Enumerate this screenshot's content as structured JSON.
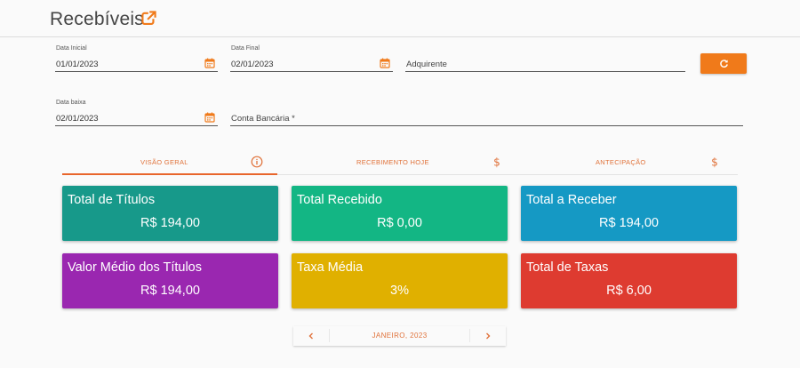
{
  "header": {
    "title": "Recebíveis",
    "icon": "external-link-icon",
    "accent": "#f07a1a"
  },
  "filters": {
    "data_inicial": {
      "label": "Data Inicial",
      "value": "01/01/2023"
    },
    "data_final": {
      "label": "Data Final",
      "value": "02/01/2023"
    },
    "adquirente": {
      "placeholder": "Adquirente"
    },
    "data_baixa": {
      "label": "Data baixa",
      "value": "02/01/2023"
    },
    "conta_bancaria": {
      "placeholder": "Conta Bancária *"
    },
    "refresh_icon": "refresh-icon"
  },
  "tabs": [
    {
      "label": "VISÃO GERAL",
      "icon": "info-icon",
      "active": true
    },
    {
      "label": "RECEBIMENTO HOJE",
      "icon": "dollar-icon",
      "active": false
    },
    {
      "label": "ANTECIPAÇÃO",
      "icon": "dollar-icon",
      "active": false
    }
  ],
  "cards": [
    {
      "title": "Total de Títulos",
      "value": "R$ 194,00",
      "color": "#17998a"
    },
    {
      "title": "Total Recebido",
      "value": "R$ 0,00",
      "color": "#13b684"
    },
    {
      "title": "Total a Receber",
      "value": "R$ 194,00",
      "color": "#1599c4"
    },
    {
      "title": "Valor Médio dos Títulos",
      "value": "R$ 194,00",
      "color": "#9a27b0"
    },
    {
      "title": "Taxa Média",
      "value": "3%",
      "color": "#e0b000"
    },
    {
      "title": "Total de Taxas",
      "value": "R$ 6,00",
      "color": "#de3b30"
    }
  ],
  "pager": {
    "label": "JANEIRO, 2023",
    "prev_icon": "chevron-left-icon",
    "next_icon": "chevron-right-icon"
  }
}
